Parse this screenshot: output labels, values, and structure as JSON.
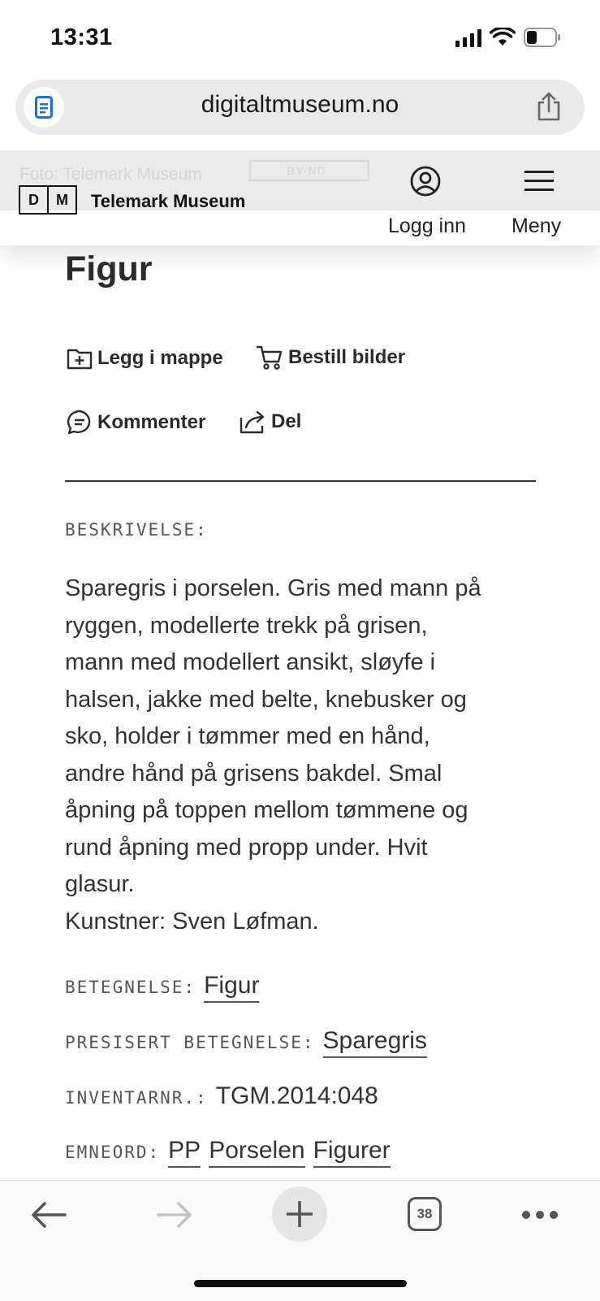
{
  "status_bar": {
    "time": "13:31"
  },
  "browser": {
    "url": "digitaltmuseum.no"
  },
  "site_header": {
    "ghost_credit": "Foto: Telemark Museum",
    "ghost_license": "BY-ND",
    "logo_left": "D",
    "logo_right": "M",
    "museum_name": "Telemark Museum",
    "login_label": "Logg inn",
    "menu_label": "Meny"
  },
  "item": {
    "title": "Figur",
    "actions": {
      "add_folder": "Legg i mappe",
      "order_images": "Bestill bilder",
      "comment": "Kommenter",
      "share": "Del"
    },
    "description_label": "BESKRIVELSE:",
    "description_lines": [
      "Sparegris i porselen. Gris med mann på",
      "ryggen, modellerte trekk på grisen,",
      "mann med modellert ansikt, sløyfe i",
      "halsen, jakke med belte, knebusker og",
      "sko, holder i tømmer med en hånd,",
      "andre hånd på grisens bakdel. Smal",
      "åpning på toppen mellom tømmene og",
      "rund åpning med propp under. Hvit",
      "glasur.",
      "Kunstner: Sven Løfman."
    ],
    "betegnelse_label": "BETEGNELSE:",
    "betegnelse_value": "Figur",
    "presisert_label": "PRESISERT BETEGNELSE:",
    "presisert_value": "Sparegris",
    "inventarnr_label": "INVENTARNR.:",
    "inventarnr_value": "TGM.2014:048",
    "emneord_label": "EMNEORD:",
    "emneord_values": [
      "PP",
      "Porselen",
      "Figurer"
    ]
  },
  "toolbar": {
    "tab_count": "38"
  }
}
